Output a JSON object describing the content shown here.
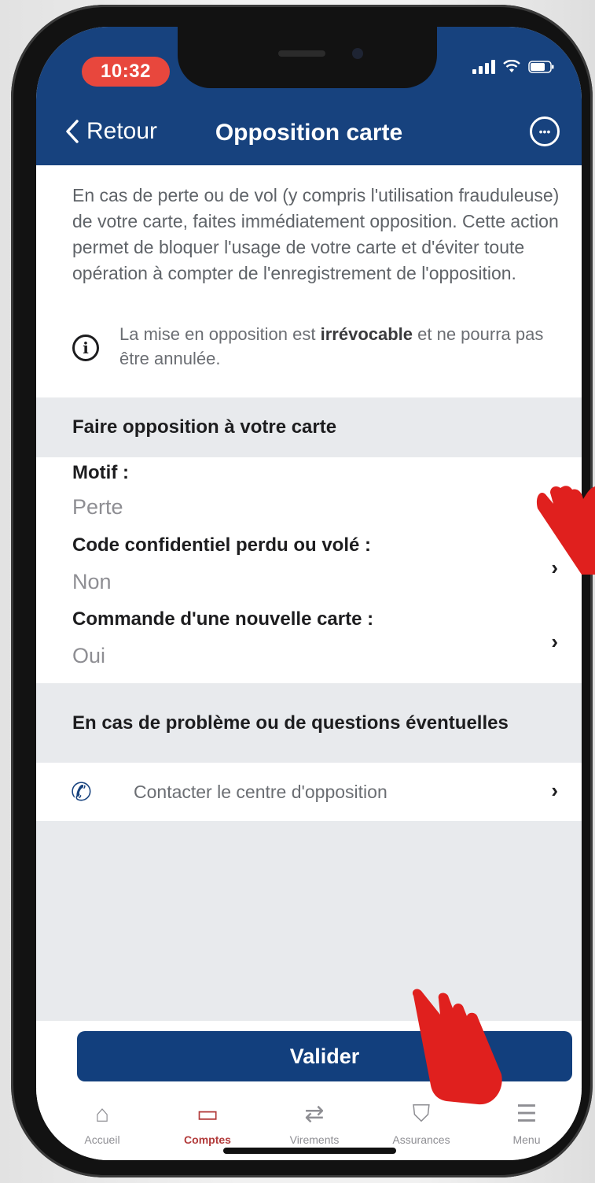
{
  "status_bar": {
    "time": "10:32"
  },
  "header": {
    "back_label": "Retour",
    "title": "Opposition carte"
  },
  "intro": {
    "text": "En cas de perte ou de vol (y compris l'utilisation frauduleuse) de votre carte, faites immédiatement opposition. Cette action permet de bloquer l'usage de votre carte et d'éviter toute opération à compter de l'enregistrement de l'opposition."
  },
  "notice": {
    "text_before": "La mise en opposition est ",
    "text_bold": "irrévocable",
    "text_after": " et ne pourra pas être annulée."
  },
  "section_opposition": {
    "title": "Faire opposition à votre carte"
  },
  "fields": [
    {
      "label": "Motif :",
      "value": "Perte"
    },
    {
      "label": "Code confidentiel perdu ou volé :",
      "value": "Non"
    },
    {
      "label": "Commande d'une nouvelle carte :",
      "value": "Oui"
    }
  ],
  "section_help": {
    "title": "En cas de problème ou de questions éventuelles"
  },
  "contact": {
    "label": "Contacter le centre d'opposition"
  },
  "validate_button": {
    "label": "Valider"
  },
  "tabs": [
    {
      "label": "Accueil",
      "icon": "home-icon",
      "active": false
    },
    {
      "label": "Comptes",
      "icon": "card-icon",
      "active": true
    },
    {
      "label": "Virements",
      "icon": "transfer-icon",
      "active": false
    },
    {
      "label": "Assurances",
      "icon": "shield-icon",
      "active": false
    },
    {
      "label": "Menu",
      "icon": "menu-icon",
      "active": false
    }
  ],
  "colors": {
    "brand": "#17427e",
    "active_tab": "#b23a3a",
    "time_badge": "#e8473d",
    "pointer_hand": "#e0201e"
  }
}
